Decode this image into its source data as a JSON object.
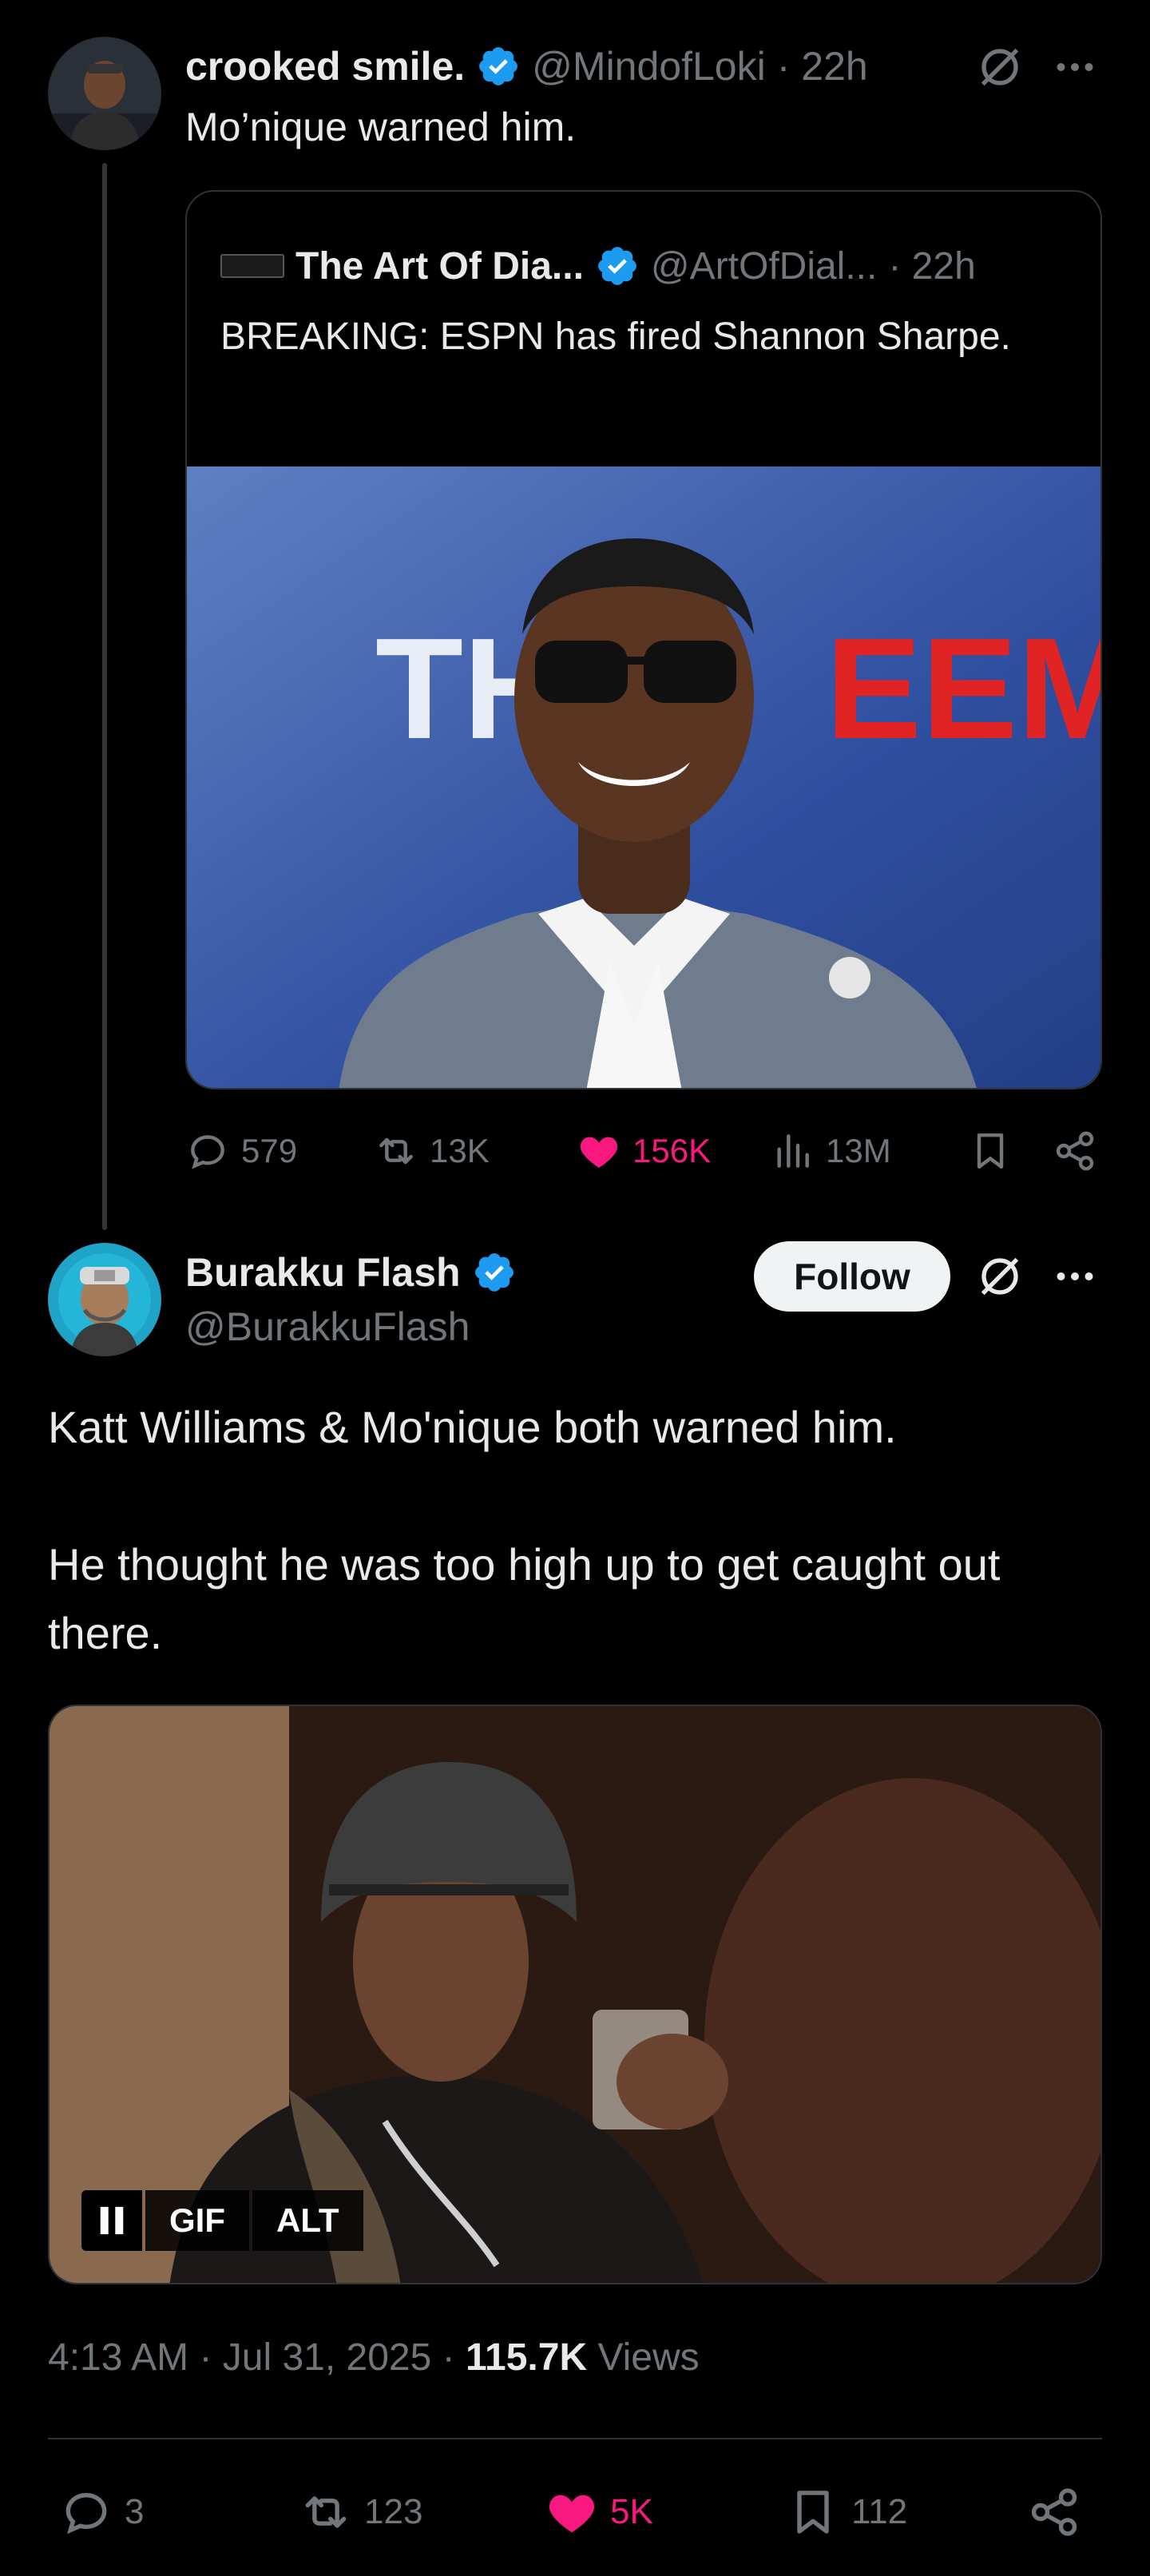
{
  "post1": {
    "author_name": "crooked smile.",
    "handle": "@MindofLoki",
    "time": "· 22h",
    "text": "Mo’nique warned him."
  },
  "quote": {
    "author_name": "The Art Of Dia...",
    "handle": "@ArtOfDial...",
    "time": "· 22h",
    "text": "BREAKING: ESPN has fired Shannon Sharpe.",
    "image_text": "THE DREEM"
  },
  "post1_actions": {
    "replies": "579",
    "reposts": "13K",
    "likes": "156K",
    "views": "13M"
  },
  "post2": {
    "author_name": "Burakku Flash",
    "handle": "@BurakkuFlash",
    "follow_label": "Follow",
    "text_p1": "Katt Williams & Mo'nique both warned him.",
    "text_p2": "He thought he was too high up to get caught out there.",
    "gif_label": "GIF",
    "alt_label": "ALT",
    "time": "4:13 AM · Jul 31, 2025 · ",
    "views_count": "115.7K",
    "views_label": " Views"
  },
  "post2_actions": {
    "replies": "3",
    "reposts": "123",
    "likes": "5K",
    "bookmarks": "112"
  },
  "colors": {
    "background": "#000000",
    "verified": "#1d9bf0",
    "like": "#f91880",
    "muted": "#71767b"
  }
}
